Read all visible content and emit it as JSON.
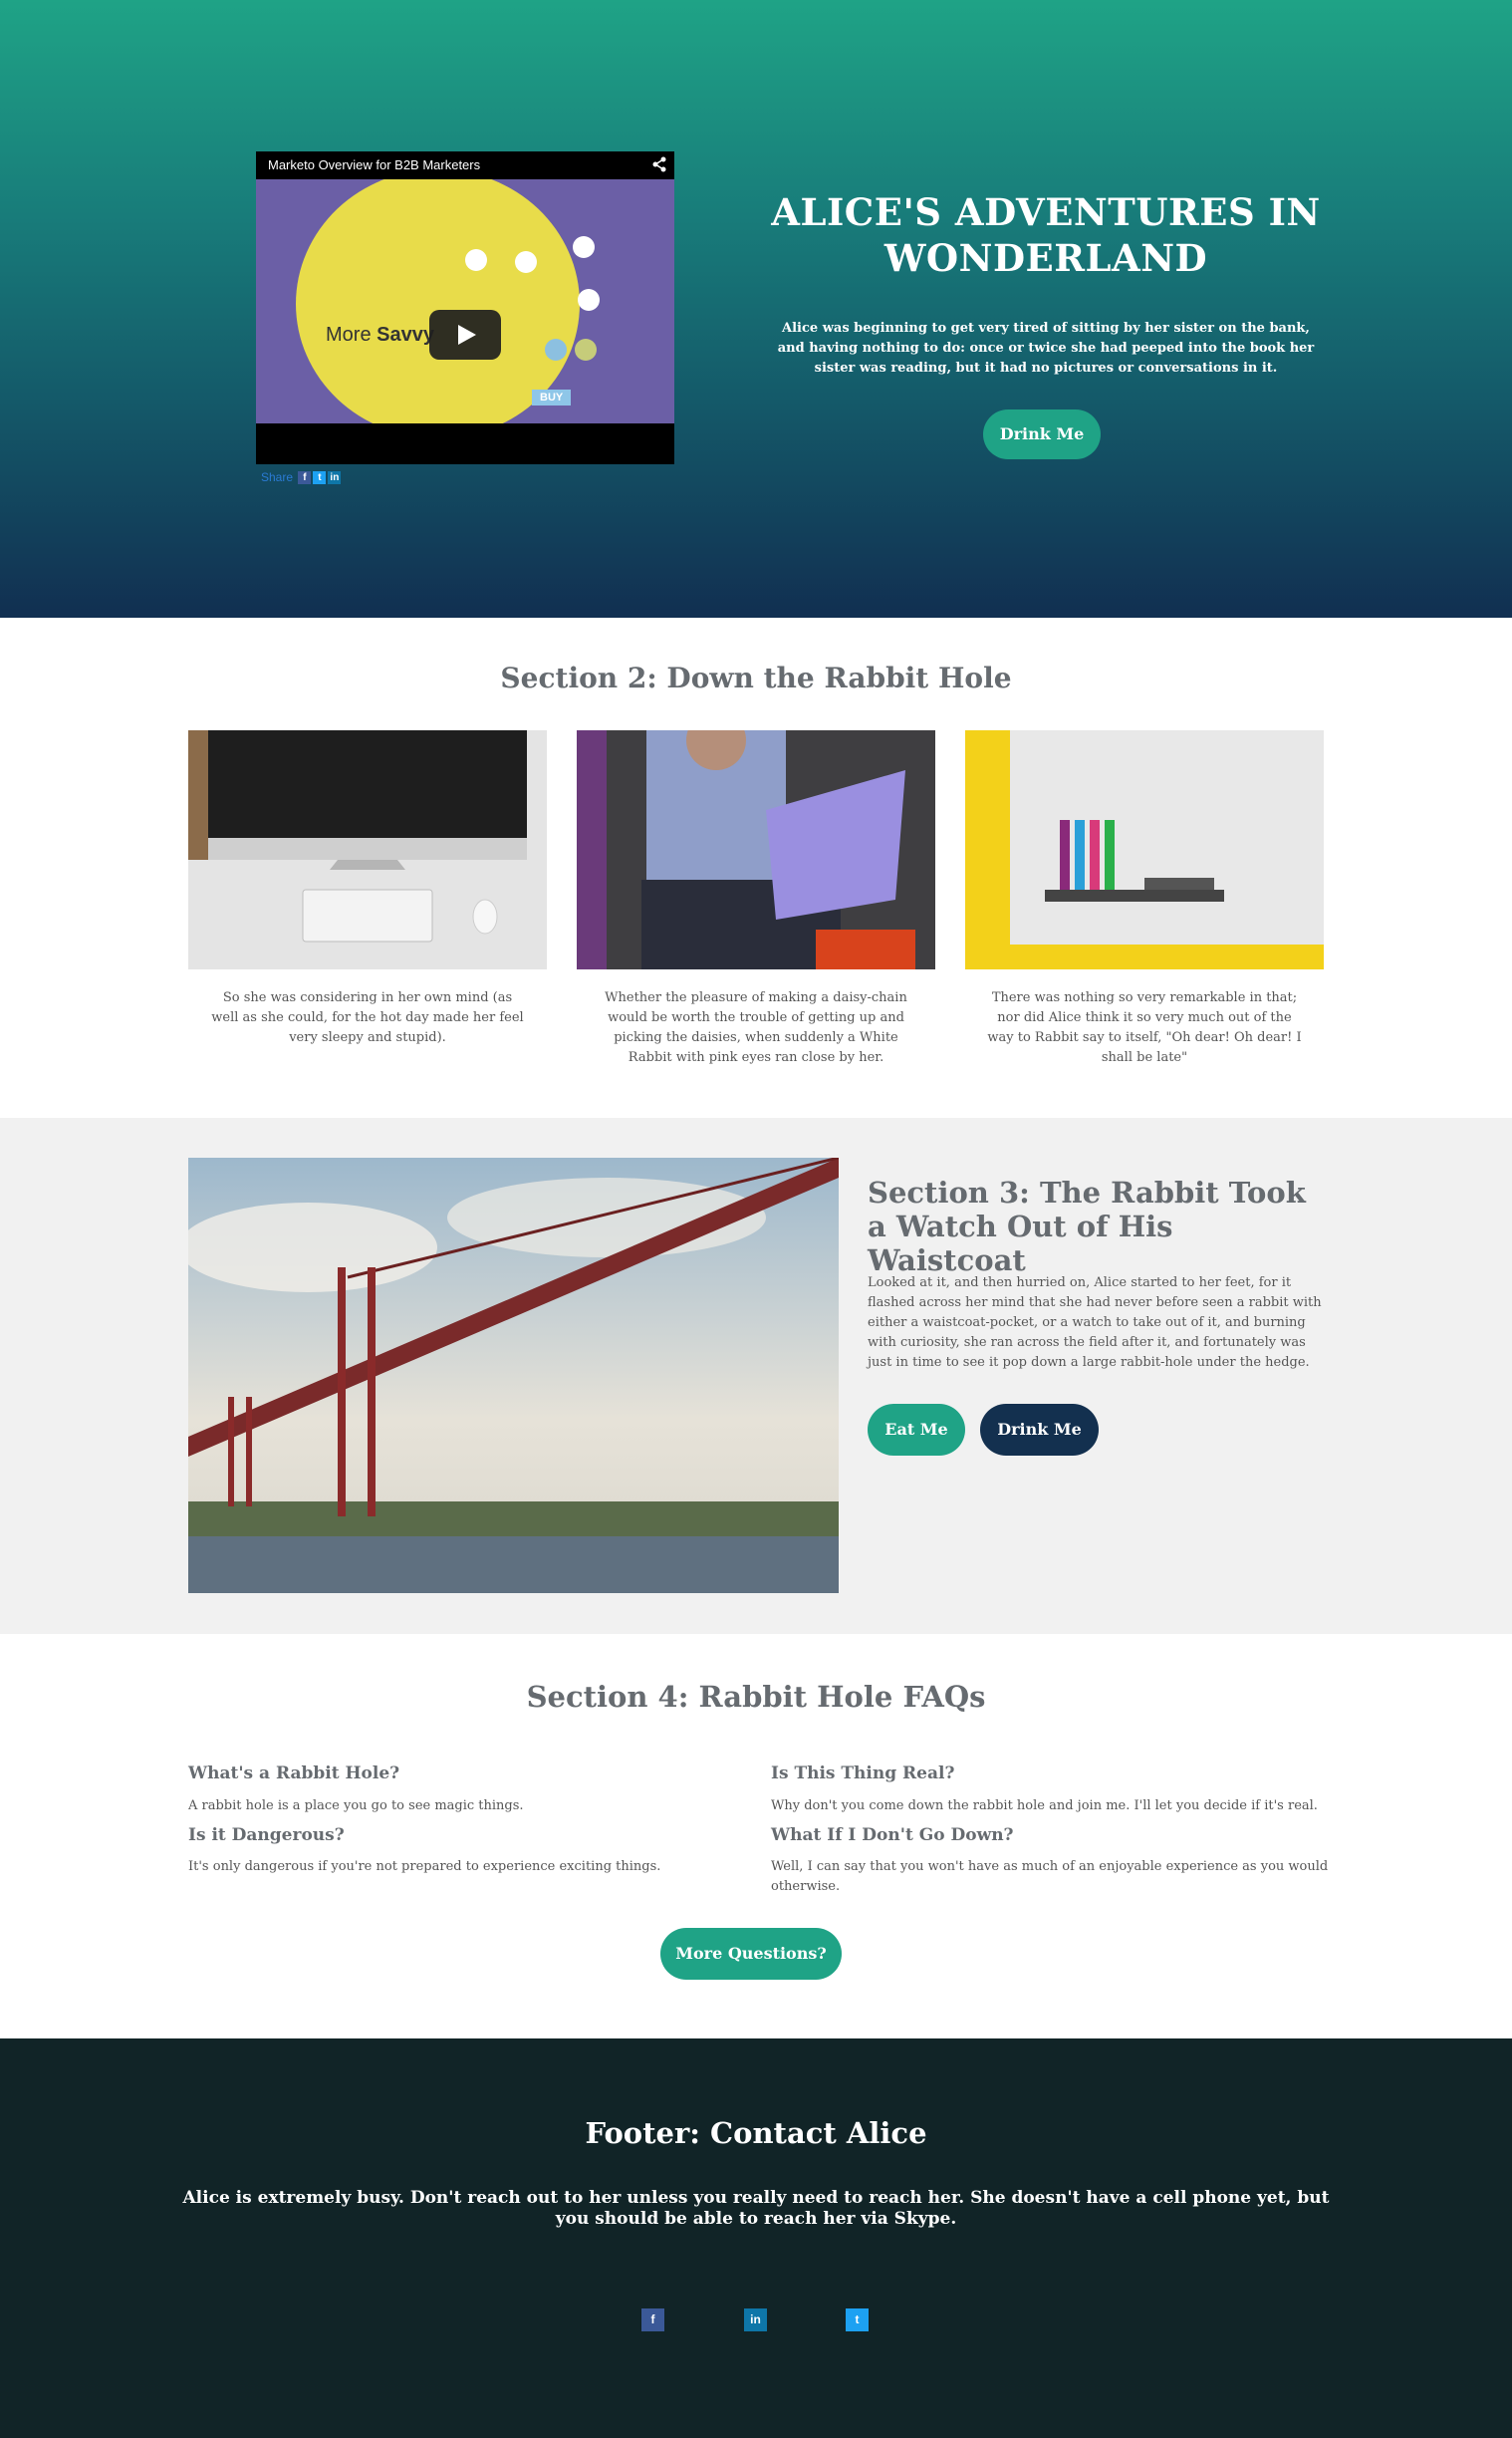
{
  "hero": {
    "video": {
      "title": "Marketo Overview for B2B Marketers",
      "frame_text_prefix": "More ",
      "frame_text_bold": "Savvy",
      "frame_badge": "BUY",
      "share_label": "Share"
    },
    "title": "ALICE'S ADVENTURES IN WONDERLAND",
    "text": "Alice was beginning to get very tired of sitting by her sister on the bank, and having nothing to do: once or twice she had peeped into the book her sister was reading, but it had no pictures or conversations in it.",
    "button": "Drink Me"
  },
  "section2": {
    "title": "Section 2: Down the Rabbit Hole",
    "cards": [
      {
        "image": "imac-desk-photo",
        "text": "So she was considering in her own mind (as well as she could, for the hot day made her feel very sleepy and stupid)."
      },
      {
        "image": "man-with-laptop-photo",
        "text": "Whether the pleasure of making a daisy-chain would be worth the trouble of getting up and picking the daisies, when suddenly a White Rabbit with pink eyes ran close by her."
      },
      {
        "image": "whiteboard-markers-photo",
        "text": "There was nothing so very remarkable in that; nor did Alice think it so very much out of the way to Rabbit say to itself, \"Oh dear! Oh dear! I shall be late\""
      }
    ]
  },
  "section3": {
    "image": "suspension-bridge-photo",
    "title": "Section 3: The Rabbit Took a Watch Out of His Waistcoat",
    "text": "Looked at it, and then hurried on, Alice started to her feet, for it flashed across her mind that she had never before seen a rabbit with either a waistcoat-pocket, or a watch to take out of it, and burning with curiosity, she ran across the field after it, and fortunately was just in time to see it pop down a large rabbit-hole under the hedge.",
    "button_primary": "Eat Me",
    "button_secondary": "Drink Me"
  },
  "section4": {
    "title": "Section 4: Rabbit Hole FAQs",
    "faqs": [
      {
        "q": "What's a Rabbit Hole?",
        "a": "A rabbit hole is a place you go to see magic things."
      },
      {
        "q": "Is it Dangerous?",
        "a": "It's only dangerous if you're not prepared to experience exciting things."
      },
      {
        "q": "Is This Thing Real?",
        "a": "Why don't you come down the rabbit hole and join me. I'll let you decide if it's real."
      },
      {
        "q": "What If I Don't Go Down?",
        "a": "Well, I can say that you won't have as much of an enjoyable experience as you would otherwise."
      }
    ],
    "button": "More Questions?"
  },
  "footer": {
    "title": "Footer: Contact Alice",
    "text": "Alice is extremely busy. Don't reach out to her unless you really need to reach her. She doesn't have a cell phone yet, but you should be able to reach her via Skype.",
    "social": [
      {
        "icon": "facebook-icon",
        "glyph": "f",
        "color": "#3b5998"
      },
      {
        "icon": "linkedin-icon",
        "glyph": "in",
        "color": "#0e76a8"
      },
      {
        "icon": "twitter-icon",
        "glyph": "t",
        "color": "#1da1f2"
      }
    ]
  },
  "colors": {
    "teal": "#1fa386",
    "navy": "#13304f",
    "footer_bg": "#112427",
    "section3_bg": "#f1f1f1",
    "heading": "#666b70"
  }
}
